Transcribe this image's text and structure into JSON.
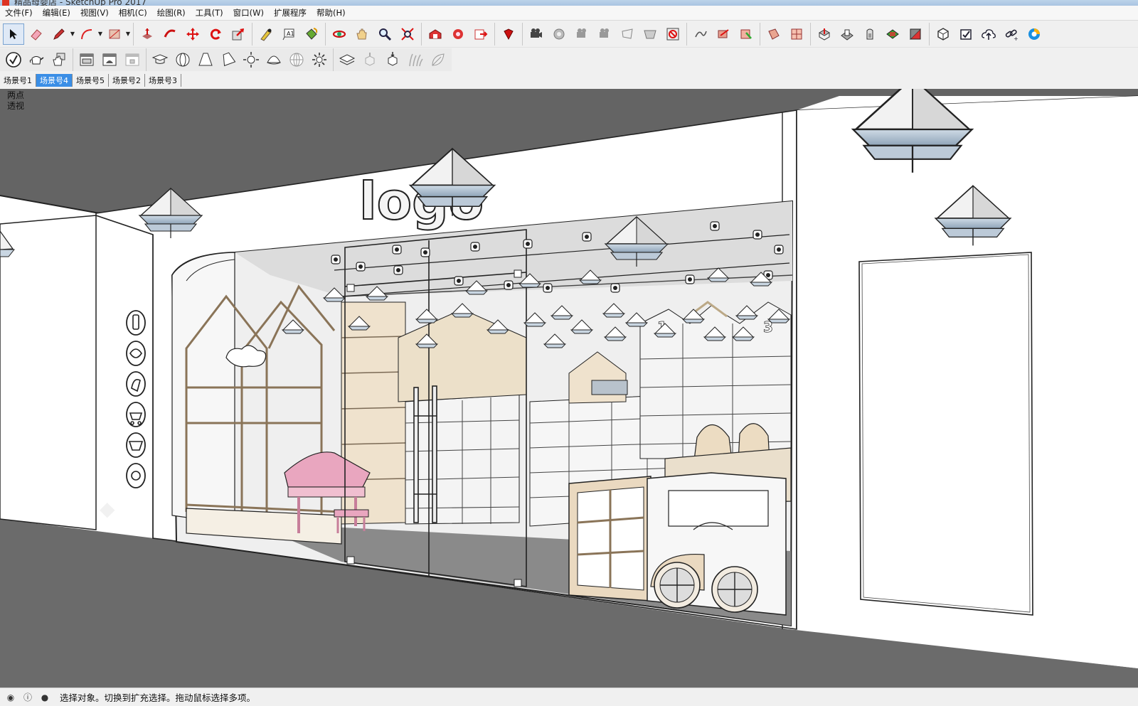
{
  "window": {
    "title": "精品母婴店 - SketchUp Pro 2017"
  },
  "menu": {
    "items": [
      "文件(F)",
      "编辑(E)",
      "视图(V)",
      "相机(C)",
      "绘图(R)",
      "工具(T)",
      "窗口(W)",
      "扩展程序",
      "帮助(H)"
    ]
  },
  "toolbar": {
    "row1": [
      [
        "select-tool-icon",
        "eraser-tool-icon",
        "pencil-tool-icon",
        "arc-tool-icon",
        "rectangle-tool-icon"
      ],
      [
        "push-pull-tool-icon",
        "follow-me-tool-icon",
        "move-tool-icon",
        "rotate-tool-icon",
        "scale-tool-icon"
      ],
      [
        "tape-measure-tool-icon",
        "text-tool-icon",
        "paint-bucket-tool-icon"
      ],
      [
        "orbit-tool-icon",
        "pan-tool-icon",
        "zoom-tool-icon",
        "zoom-extents-tool-icon"
      ],
      [
        "warehouse-icon",
        "extension-warehouse-icon",
        "layout-send-icon"
      ],
      [
        "ruby-console-icon"
      ],
      [
        "camera-position-icon",
        "look-around-icon",
        "walk-icon",
        "section-plane-icon",
        "section-cut-icon",
        "display-section-icon",
        "cancel-section-icon"
      ],
      [
        "sandbox-smoove-icon",
        "sandbox-stamp-icon",
        "sandbox-drape-icon"
      ],
      [
        "terrain-add-detail-icon",
        "terrain-flip-icon"
      ],
      [
        "solid-union-icon",
        "solid-subtract-icon",
        "solid-trim-icon",
        "solid-intersect-icon",
        "solid-split-icon"
      ],
      [
        "3d-warehouse-share-icon",
        "model-info-icon",
        "cloud-upload-icon",
        "link-icon",
        "vray-icon"
      ]
    ],
    "row2": [
      [
        "validate-icon",
        "teapot-icon",
        "hand-icon"
      ],
      [
        "window-style-icon",
        "window-preview-icon",
        "lock-icon"
      ],
      [
        "geo-cap-icon",
        "sphere-icon",
        "cone-light-icon",
        "spot-light-icon",
        "sun-icon",
        "half-sphere-icon",
        "globe-icon",
        "settings-sun-icon"
      ],
      [
        "layers-icon",
        "component-up-icon",
        "component-down-icon",
        "grass-icon",
        "leaf-icon"
      ]
    ]
  },
  "scene_tabs": {
    "items": [
      "场景号1",
      "场景号4",
      "场景号5",
      "场景号2",
      "场景号3"
    ],
    "active_index": 1
  },
  "viewport": {
    "camera_label_line1": "两点",
    "camera_label_line2": "透视",
    "signage_text": "logo",
    "shelf_number_1": "1",
    "shelf_number_3": "3"
  },
  "status": {
    "message": "选择对象。切换到扩充选择。拖动鼠标选择多项。",
    "icons": [
      "geo-location-icon",
      "info-icon",
      "user-account-icon"
    ]
  },
  "colors": {
    "ceiling_gray": "#646464",
    "floor_gray": "#6c6c6c",
    "wood": "#e8dcc9",
    "piano_pink": "#e9a6bf",
    "lamp_shade": "#cfe0ef",
    "active_tab": "#3a8ee6"
  }
}
